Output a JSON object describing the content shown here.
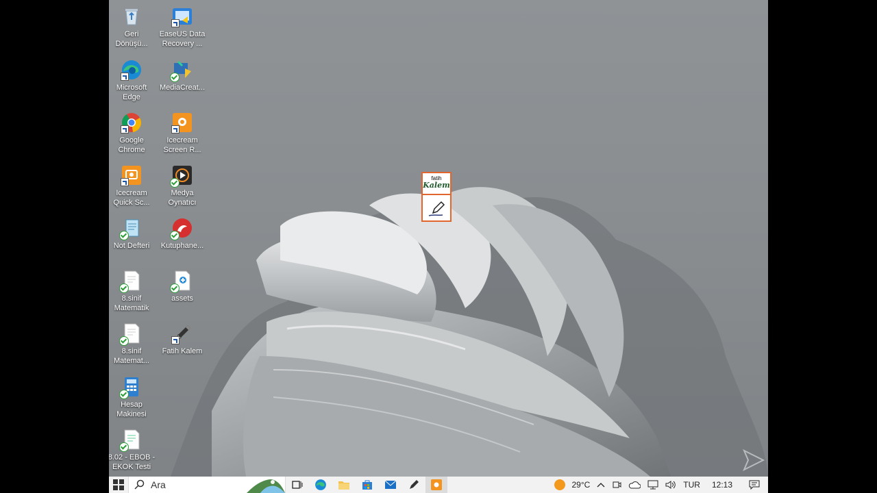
{
  "desktop": {
    "icons": [
      {
        "label": "Geri\nDönüşü...",
        "icon": "recycle-bin-icon"
      },
      {
        "label": "EaseUS Data\nRecovery ...",
        "icon": "easeus-icon"
      },
      {
        "label": "Microsoft\nEdge",
        "icon": "edge-icon"
      },
      {
        "label": "MediaCreat...",
        "icon": "media-creation-icon"
      },
      {
        "label": "Google\nChrome",
        "icon": "chrome-icon"
      },
      {
        "label": "Icecream\nScreen R...",
        "icon": "icecream-screen-icon"
      },
      {
        "label": "Icecream\nQuick Sc...",
        "icon": "icecream-quick-icon"
      },
      {
        "label": "Medya\nOynatıcı",
        "icon": "media-player-icon"
      },
      {
        "label": "Not Defteri",
        "icon": "notepad-icon"
      },
      {
        "label": "Kutuphane...",
        "icon": "library-icon"
      },
      {
        "label": "8.sinif\nMatematik",
        "icon": "document-icon"
      },
      {
        "label": "assets",
        "icon": "assets-icon"
      },
      {
        "label": "8.sinif\nMatemat...",
        "icon": "document-icon"
      },
      {
        "label": "Fatih Kalem",
        "icon": "pen-icon"
      },
      {
        "label": "Hesap\nMakinesi",
        "icon": "calculator-icon"
      },
      {
        "label": "8.02 - EBOB -\nEKOK Testi",
        "icon": "document-icon"
      }
    ]
  },
  "widget": {
    "line1": "fatih",
    "line2": "Kalem"
  },
  "taskbar": {
    "search_placeholder": "Ara",
    "weather": "29°C",
    "language": "TUR",
    "time": "12:13"
  },
  "colors": {
    "accent": "#e2652e",
    "taskbar": "#f2f2f2"
  }
}
